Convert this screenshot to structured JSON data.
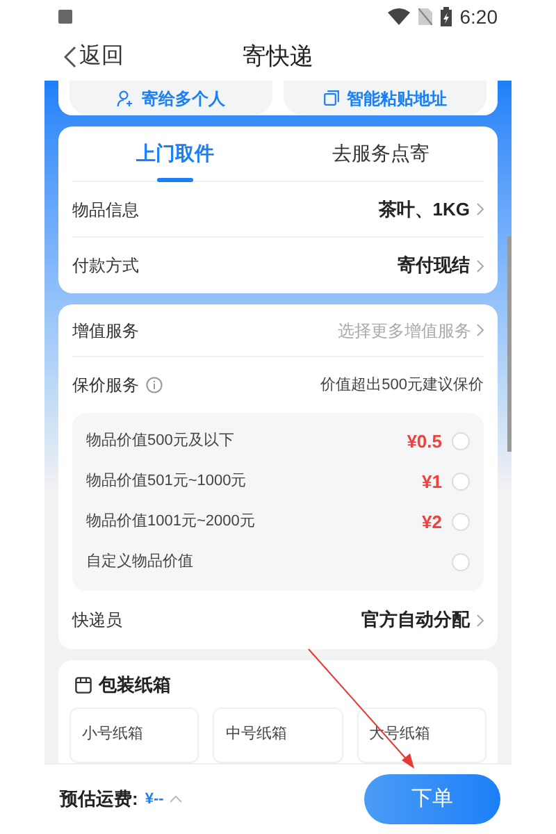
{
  "status_bar": {
    "time": "6:20"
  },
  "nav": {
    "back": "返回",
    "title": "寄快递"
  },
  "quick_actions": [
    {
      "label": "寄给多个人",
      "kind": "person"
    },
    {
      "label": "智能粘贴地址",
      "kind": "copy"
    }
  ],
  "tabs": [
    {
      "label": "上门取件",
      "selected": true
    },
    {
      "label": "去服务点寄",
      "selected": false
    }
  ],
  "order_rows": [
    {
      "label": "物品信息",
      "value": "茶叶、1KG"
    },
    {
      "label": "付款方式",
      "value": "寄付现结"
    }
  ],
  "value_added": {
    "label": "增值服务",
    "value": "选择更多增值服务"
  },
  "insurance": {
    "label": "保价服务",
    "hint": "价值超出500元建议保价",
    "options": [
      {
        "label": "物品价值500元及以下",
        "price": "¥0.5",
        "checked": false
      },
      {
        "label": "物品价值501元~1000元",
        "price": "¥1",
        "checked": false
      },
      {
        "label": "物品价值1001元~2000元",
        "price": "¥2",
        "checked": false
      },
      {
        "label": "自定义物品价值",
        "checked": false
      }
    ]
  },
  "courier": {
    "label": "快递员",
    "value": "官方自动分配"
  },
  "packaging": {
    "title": "包装纸箱",
    "boxes": [
      "小号纸箱",
      "中号纸箱",
      "大号纸箱"
    ]
  },
  "footer": {
    "label": "预估运费:",
    "price": "¥--",
    "button": "下单"
  }
}
